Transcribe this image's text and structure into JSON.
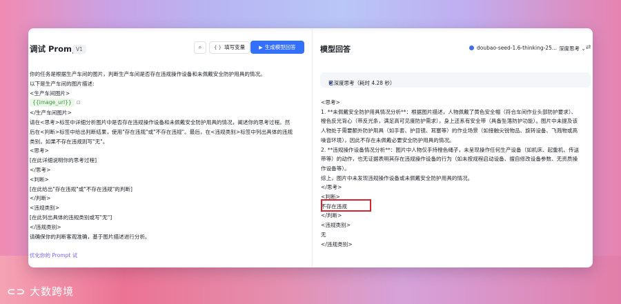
{
  "faint_tabs": "",
  "left": {
    "title": "调试 Prompt",
    "version": "V1",
    "image_button_icon": "image-search-icon",
    "fill_vars_label": "填写变量",
    "generate_label": "生成模型回答",
    "prompt_lines": [
      "你的任务是根据生产车间的图片，判断生产车间是否存在违规操作设备和未佩戴安全防护用具的情况。",
      "以下是生产车间的图片描述:",
      "<生产车间图片>",
      "{{image_url}}",
      "</生产车间图片>",
      "请在<思考>标签中详细分析图片中是否存在违规操作设备和未佩戴安全防护用具的情况，阐述你的思考过程。然",
      "后在<判断>标签中给出判断结果，使用\"存在违规\"或\"不存在违规\"。最后，在<违规类别>标签中列出具体的违规",
      "类别，如果不存在违规则写\"无\"。",
      "<思考>",
      "[在此详细说明你的思考过程]",
      "</思考>",
      "<判断>",
      "[在此给出\"存在违规\"或\"不存在违规\"的判断]",
      "</判断>",
      "<违规类别>",
      "[在此列出具体的违规类别或写\"无\"]",
      "</违规类别>",
      "请确保你的判断客观准确，基于图片描述进行分析。"
    ],
    "optimize_label": "优化你的 Prompt 试"
  },
  "right": {
    "title": "模型回答",
    "model_name": "doubao-seed-1.6-thinking-25...",
    "deep_think_label": "深度思考",
    "thinking_chip": "已深度思考（耗时 4.28 秒）",
    "response_lines": [
      "<思考>",
      "1. **未佩戴安全防护用具情况分析**：根据图片描述，人物佩戴了黄色安全帽（符合车间作业头部防护要求）、",
      "橙色反光背心（带反光条，满足高可见度防护需求），身上还系有安全带（具备坠落防护功能）。图片中未提及该",
      "人物处于需要额外防护用具（如手套、护目镜、耳塞等）的作业场景（如接触尖锐物品、旋转设备、飞溅物或高",
      "噪音环境），因此不存在未佩戴必要安全防护用具的情况。",
      "2. **违规操作设备情况分析**：图片中人物仅手持橙色绳子，未呈现操作任何生产设备（如机床、起重机、传送",
      "带等）的动作，也无证据表明其存在违规操作设备的行为（如未按规程启动设备、擅自修改设备参数、无资质操",
      "作设备等）。",
      "综上，图片中未发现违规操作设备或未佩戴安全防护用具的情况。",
      "</思考>",
      "<判断>",
      "不存在违规",
      "</判断>",
      "<违规类别>",
      "无",
      "</违规类别>"
    ]
  },
  "footer_small": "",
  "watermark": "大数跨境",
  "colors": {
    "primary": "#3370ff",
    "highlight": "#d6232e",
    "var_bg": "#eaf7e9",
    "var_text": "#3a9a3a",
    "optimize": "#7b61ff"
  }
}
